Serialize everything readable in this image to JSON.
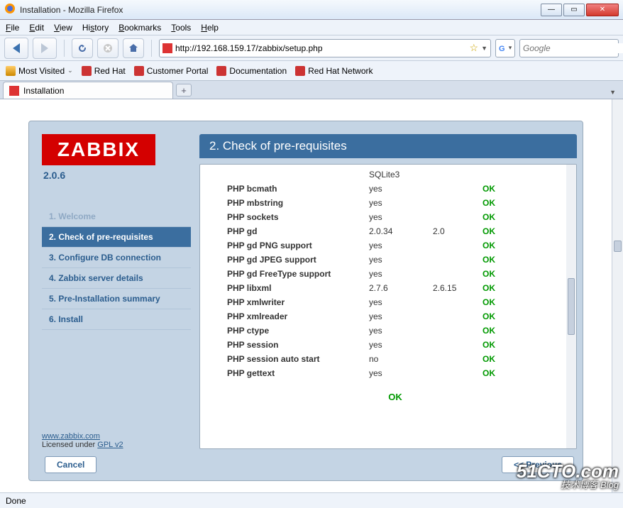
{
  "window": {
    "title": "Installation - Mozilla Firefox"
  },
  "menu": {
    "file": "File",
    "edit": "Edit",
    "view": "View",
    "history": "History",
    "bookmarks": "Bookmarks",
    "tools": "Tools",
    "help": "Help"
  },
  "nav": {
    "url": "http://192.168.159.17/zabbix/setup.php",
    "search_placeholder": "Google"
  },
  "bookmarks": {
    "most_visited": "Most Visited",
    "items": [
      {
        "label": "Red Hat"
      },
      {
        "label": "Customer Portal"
      },
      {
        "label": "Documentation"
      },
      {
        "label": "Red Hat Network"
      }
    ]
  },
  "tab": {
    "title": "Installation"
  },
  "zabbix": {
    "logo": "ZABBIX",
    "version": "2.0.6",
    "steps": [
      {
        "label": "1. Welcome",
        "state": "faded"
      },
      {
        "label": "2. Check of pre-requisites",
        "state": "active"
      },
      {
        "label": "3. Configure DB connection",
        "state": "normal"
      },
      {
        "label": "4. Zabbix server details",
        "state": "normal"
      },
      {
        "label": "5. Pre-Installation summary",
        "state": "normal"
      },
      {
        "label": "6. Install",
        "state": "normal"
      }
    ],
    "step_title": "2. Check of pre-requisites",
    "top_value": "SQLite3",
    "checks": [
      {
        "name": "PHP bcmath",
        "current": "yes",
        "required": "",
        "status": "OK"
      },
      {
        "name": "PHP mbstring",
        "current": "yes",
        "required": "",
        "status": "OK"
      },
      {
        "name": "PHP sockets",
        "current": "yes",
        "required": "",
        "status": "OK"
      },
      {
        "name": "PHP gd",
        "current": "2.0.34",
        "required": "2.0",
        "status": "OK"
      },
      {
        "name": "PHP gd PNG support",
        "current": "yes",
        "required": "",
        "status": "OK"
      },
      {
        "name": "PHP gd JPEG support",
        "current": "yes",
        "required": "",
        "status": "OK"
      },
      {
        "name": "PHP gd FreeType support",
        "current": "yes",
        "required": "",
        "status": "OK"
      },
      {
        "name": "PHP libxml",
        "current": "2.7.6",
        "required": "2.6.15",
        "status": "OK"
      },
      {
        "name": "PHP xmlwriter",
        "current": "yes",
        "required": "",
        "status": "OK"
      },
      {
        "name": "PHP xmlreader",
        "current": "yes",
        "required": "",
        "status": "OK"
      },
      {
        "name": "PHP ctype",
        "current": "yes",
        "required": "",
        "status": "OK"
      },
      {
        "name": "PHP session",
        "current": "yes",
        "required": "",
        "status": "OK"
      },
      {
        "name": "PHP session auto start",
        "current": "no",
        "required": "",
        "status": "OK"
      },
      {
        "name": "PHP gettext",
        "current": "yes",
        "required": "",
        "status": "OK"
      }
    ],
    "overall": "OK",
    "footer": {
      "site": "www.zabbix.com",
      "license_pre": "Licensed under ",
      "license_link": "GPL v2"
    },
    "buttons": {
      "cancel": "Cancel",
      "prev": "<< Previous"
    }
  },
  "status": {
    "text": "Done"
  },
  "watermark": {
    "big": "51CTO.com",
    "small": "技术博客  Blog"
  }
}
